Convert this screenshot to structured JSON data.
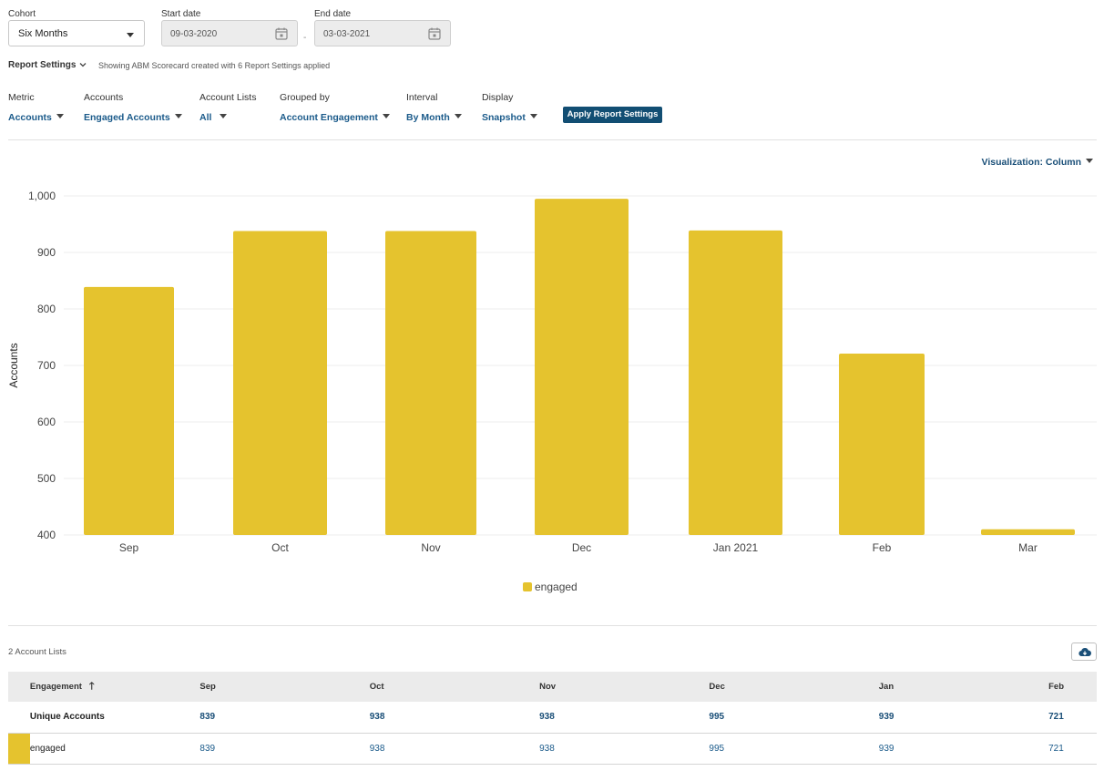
{
  "filters_top": {
    "cohort_label": "Cohort",
    "cohort_value": "Six Months",
    "start_label": "Start date",
    "start_value": "09-03-2020",
    "end_label": "End date",
    "end_value": "03-03-2021",
    "dash": "-"
  },
  "report_settings": {
    "title": "Report Settings",
    "note": "Showing ABM Scorecard created with 6 Report Settings applied"
  },
  "filters": {
    "metric_label": "Metric",
    "metric_value": "Accounts",
    "accounts_label": "Accounts",
    "accounts_value": "Engaged Accounts",
    "lists_label": "Account Lists",
    "lists_value": "All",
    "grouped_label": "Grouped by",
    "grouped_value": "Account Engagement",
    "interval_label": "Interval",
    "interval_value": "By Month",
    "display_label": "Display",
    "display_value": "Snapshot",
    "apply_label": "Apply Report Settings"
  },
  "visualization_label": "Visualization: Column",
  "chart_data": {
    "type": "bar",
    "categories": [
      "Sep",
      "Oct",
      "Nov",
      "Dec",
      "Jan 2021",
      "Feb",
      "Mar"
    ],
    "series": [
      {
        "name": "engaged",
        "values": [
          839,
          938,
          938,
          995,
          939,
          721,
          410
        ],
        "color": "#e5c32e"
      }
    ],
    "ylabel": "Accounts",
    "ylim": [
      400,
      1000
    ],
    "yticks": [
      "400",
      "500",
      "600",
      "700",
      "800",
      "900",
      "1,000"
    ],
    "grid": true,
    "legend": "bottom-center"
  },
  "table": {
    "count_label": "2 Account Lists",
    "headers": [
      "Engagement",
      "Sep",
      "Oct",
      "Nov",
      "Dec",
      "Jan",
      "Feb"
    ],
    "sort_icon": "arrow-up-icon",
    "rows": [
      {
        "label": "Unique Accounts",
        "values": [
          "839",
          "938",
          "938",
          "995",
          "939",
          "721"
        ]
      },
      {
        "label": "engaged",
        "values": [
          "839",
          "938",
          "938",
          "995",
          "939",
          "721"
        ],
        "swatch": "#e5c32e"
      }
    ]
  }
}
